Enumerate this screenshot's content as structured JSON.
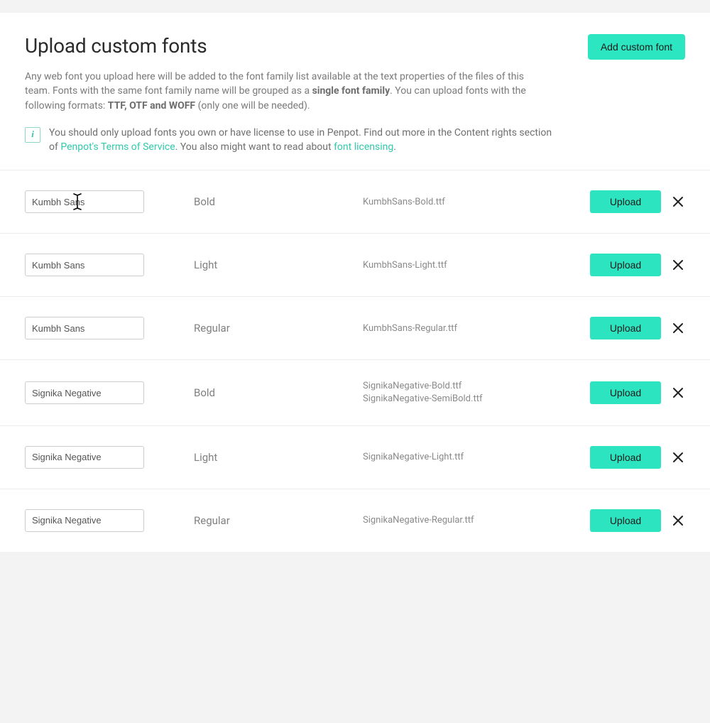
{
  "header": {
    "title": "Upload custom fonts",
    "add_button_label": "Add custom font"
  },
  "description": {
    "part1": "Any web font you upload here will be added to the font family list available at the text properties of the files of this team. Fonts with the same font family name will be grouped as a ",
    "bold1": "single font family",
    "part2": ". You can upload fonts with the following formats: ",
    "bold2": "TTF, OTF and WOFF",
    "part3": " (only one will be needed)."
  },
  "info": {
    "text_before_link1": "You should only upload fonts you own or have license to use in Penpot. Find out more in the Content rights section of ",
    "link1_label": "Penpot's Terms of Service",
    "text_between": ". You also might want to read about ",
    "link2_label": "font licensing",
    "text_after": "."
  },
  "labels": {
    "upload": "Upload"
  },
  "fonts": [
    {
      "name": "Kumbh Sans",
      "variant": "Bold",
      "files": [
        "KumbhSans-Bold.ttf"
      ]
    },
    {
      "name": "Kumbh Sans",
      "variant": "Light",
      "files": [
        "KumbhSans-Light.ttf"
      ]
    },
    {
      "name": "Kumbh Sans",
      "variant": "Regular",
      "files": [
        "KumbhSans-Regular.ttf"
      ]
    },
    {
      "name": "Signika Negative",
      "variant": "Bold",
      "files": [
        "SignikaNegative-Bold.ttf",
        "SignikaNegative-SemiBold.ttf"
      ]
    },
    {
      "name": "Signika Negative",
      "variant": "Light",
      "files": [
        "SignikaNegative-Light.ttf"
      ]
    },
    {
      "name": "Signika Negative",
      "variant": "Regular",
      "files": [
        "SignikaNegative-Regular.ttf"
      ]
    }
  ],
  "cursor": {
    "visible_row_index": 0
  }
}
